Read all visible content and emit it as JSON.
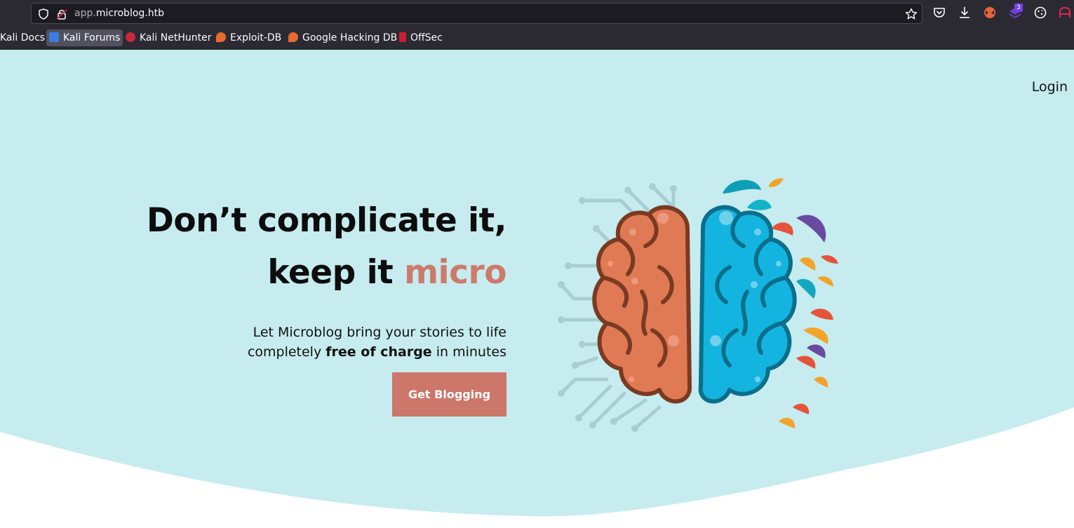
{
  "browser": {
    "url_sub": "app.",
    "url_domain": "microblog.htb",
    "extension_badge": "3",
    "bookmarks": [
      {
        "label": "Kali Docs",
        "icon": "kali-docs-icon"
      },
      {
        "label": "Kali Forums",
        "icon": "kali-forums-icon"
      },
      {
        "label": "Kali NetHunter",
        "icon": "kali-nethunter-icon"
      },
      {
        "label": "Exploit-DB",
        "icon": "exploit-db-icon"
      },
      {
        "label": "Google Hacking DB",
        "icon": "ghdb-icon"
      },
      {
        "label": "OffSec",
        "icon": "offsec-icon"
      }
    ]
  },
  "nav": {
    "login": "Login"
  },
  "hero": {
    "line1": "Don’t complicate it,",
    "line2_prefix": "keep it ",
    "line2_accent": "micro",
    "sub_line1": "Let Microblog bring your stories to life",
    "sub_line2_prefix": "completely ",
    "sub_line2_bold": "free of charge",
    "sub_line2_suffix": " in minutes",
    "cta": "Get Blogging"
  },
  "colors": {
    "hero_bg": "#c6ecef",
    "accent": "#cd7a6c",
    "button": "#cd766a",
    "brain_left": "#e07a55",
    "brain_right": "#14b4e0"
  }
}
